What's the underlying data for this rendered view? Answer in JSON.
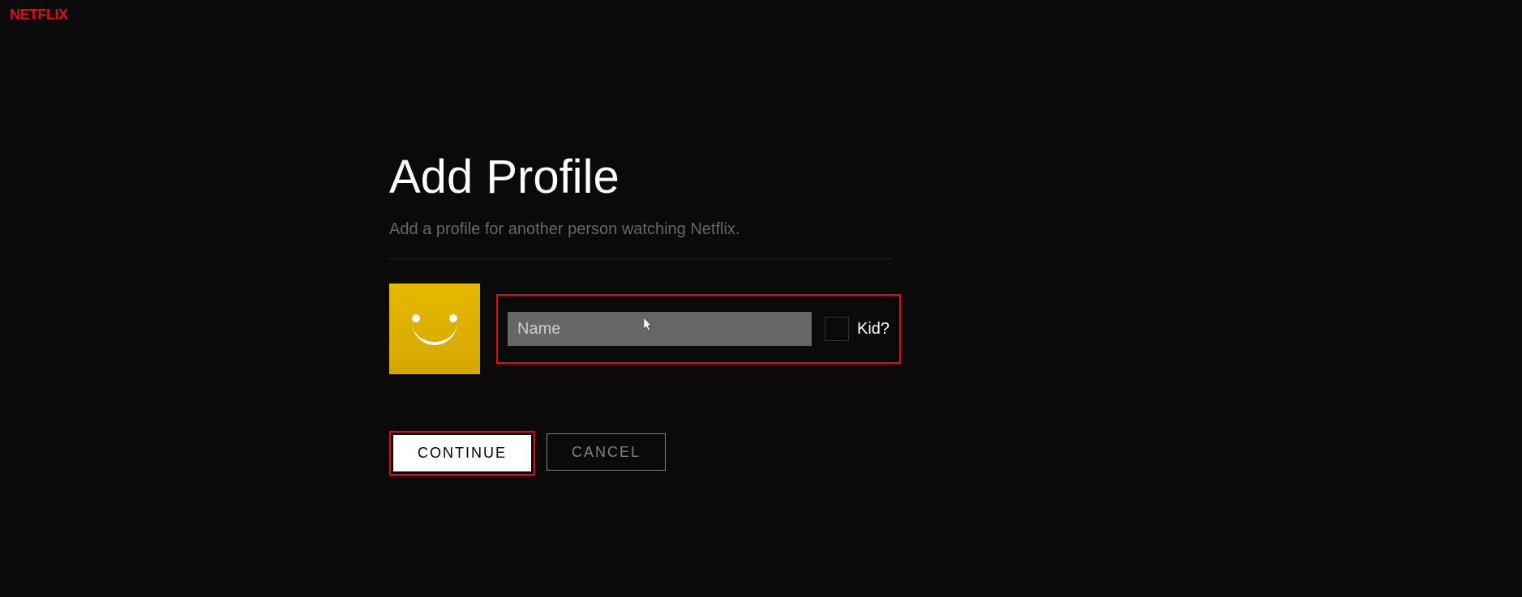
{
  "logo": "NETFLIX",
  "page": {
    "title": "Add Profile",
    "subtitle": "Add a profile for another person watching Netflix."
  },
  "form": {
    "name_placeholder": "Name",
    "name_value": "",
    "kid_label": "Kid?"
  },
  "buttons": {
    "continue": "CONTINUE",
    "cancel": "CANCEL"
  },
  "avatar": {
    "icon_name": "smile-avatar"
  }
}
